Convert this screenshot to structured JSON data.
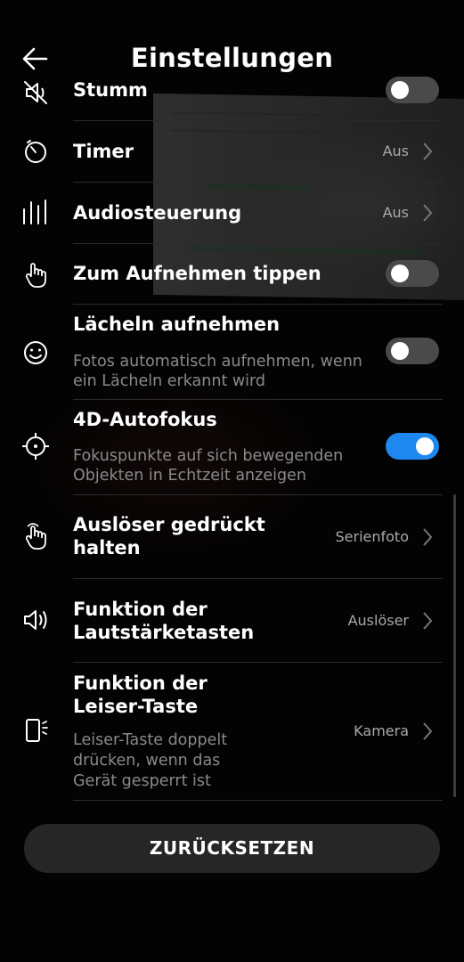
{
  "header": {
    "title": "Einstellungen",
    "back_icon": "arrow-left-icon"
  },
  "items": [
    {
      "key": "stumm",
      "icon": "mute-icon",
      "label": "Stumm",
      "control": "toggle",
      "on": false
    },
    {
      "key": "timer",
      "icon": "timer-icon",
      "label": "Timer",
      "value": "Aus"
    },
    {
      "key": "audio",
      "icon": "audio-bars-icon",
      "label": "Audiosteuerung",
      "value": "Aus"
    },
    {
      "key": "tap",
      "icon": "tap-hand-icon",
      "label": "Zum Aufnehmen tippen",
      "control": "toggle",
      "on": false
    },
    {
      "key": "smile",
      "icon": "smile-icon",
      "label": "Lächeln aufnehmen",
      "sub_line1": "Fotos automatisch aufnehmen, wenn",
      "sub_line2": "ein Lächeln erkannt wird",
      "control": "toggle",
      "on": false
    },
    {
      "key": "autofocus",
      "icon": "crosshair-icon",
      "label": "4D-Autofokus",
      "sub_line1": "Fokuspunkte auf sich bewegenden",
      "sub_line2": "Objekten in Echtzeit anzeigen",
      "control": "toggle",
      "on": true
    },
    {
      "key": "shutter",
      "icon": "press-hand-icon",
      "label_line1": "Auslöser gedrückt",
      "label_line2": "halten",
      "value": "Serienfoto"
    },
    {
      "key": "volume",
      "icon": "speaker-icon",
      "label_line1": "Funktion der",
      "label_line2": "Lautstärketasten",
      "value": "Auslöser"
    },
    {
      "key": "quieter",
      "icon": "phone-side-key-icon",
      "label_line1": "Funktion der",
      "label_line2": "Leiser-Taste",
      "sub_line1": "Leiser-Taste doppelt",
      "sub_line2": "drücken, wenn das",
      "sub_line3": "Gerät gesperrt ist",
      "value": "Kamera"
    }
  ],
  "reset_label": "ZURÜCKSETZEN",
  "colors": {
    "accent": "#1e88f0",
    "background": "#000000",
    "secondary_text": "#8a8a8a",
    "value_text": "#a9a9a9",
    "button_bg": "#262626"
  }
}
